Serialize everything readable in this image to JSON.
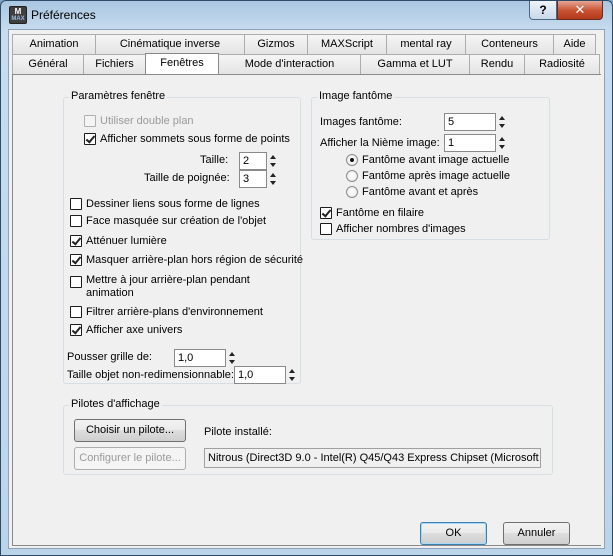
{
  "window": {
    "title": "Préférences",
    "icon_text": "M",
    "icon_sub": "MAX",
    "help_label": "?",
    "close_label": "✕"
  },
  "tabs": {
    "row1": [
      "Animation",
      "Cinématique inverse",
      "Gizmos",
      "MAXScript",
      "mental ray",
      "Conteneurs",
      "Aide"
    ],
    "row2": [
      "Général",
      "Fichiers",
      "Fenêtres",
      "Mode d'interaction",
      "Gamma et LUT",
      "Rendu",
      "Radiosité"
    ],
    "active": "Fenêtres"
  },
  "viewport_params": {
    "title": "Paramètres fenêtre",
    "double_buffer": {
      "label": "Utiliser double plan",
      "checked": false,
      "disabled": true
    },
    "show_vertices": {
      "label": "Afficher sommets sous forme de points",
      "checked": true
    },
    "size_label": "Taille:",
    "size_value": "2",
    "handle_size_label": "Taille de poignée:",
    "handle_size_value": "3",
    "draw_links": {
      "label": "Dessiner liens sous forme de lignes",
      "checked": false
    },
    "backface_cull": {
      "label": "Face masquée sur création de l'objet",
      "checked": false
    },
    "attenuate_lights": {
      "label": "Atténuer lumière",
      "checked": true
    },
    "mask_background": {
      "label": "Masquer arrière-plan hors région de sécurité",
      "checked": true
    },
    "update_background": {
      "label": "Mettre à jour arrière-plan pendant animation",
      "checked": false
    },
    "filter_env_backgrounds": {
      "label": "Filtrer arrière-plans d'environnement",
      "checked": false
    },
    "display_world_axis": {
      "label": "Afficher axe univers",
      "checked": true
    },
    "grid_nudge_label": "Pousser grille de:",
    "grid_nudge_value": "1,0",
    "non_scaling_label": "Taille objet non-redimensionnable:",
    "non_scaling_value": "1,0"
  },
  "ghosting": {
    "title": "Image fantôme",
    "ghost_frames_label": "Images fantôme:",
    "ghost_frames_value": "5",
    "nth_frame_label": "Afficher la Nième image:",
    "nth_frame_value": "1",
    "options": [
      "Fantôme avant image actuelle",
      "Fantôme après image actuelle",
      "Fantôme avant et après"
    ],
    "selected_option": 0,
    "wireframe": {
      "label": "Fantôme en filaire",
      "checked": true
    },
    "show_frame_numbers": {
      "label": "Afficher nombres d'images",
      "checked": false
    }
  },
  "display_drivers": {
    "title": "Pilotes d'affichage",
    "choose_button": "Choisir un pilote...",
    "configure_button": "Configurer le pilote...",
    "installed_label": "Pilote installé:",
    "installed_value": "Nitrous (Direct3D 9.0 - Intel(R) Q45/Q43 Express Chipset (Microsoft"
  },
  "footer": {
    "ok_label": "OK",
    "cancel_label": "Annuler"
  }
}
